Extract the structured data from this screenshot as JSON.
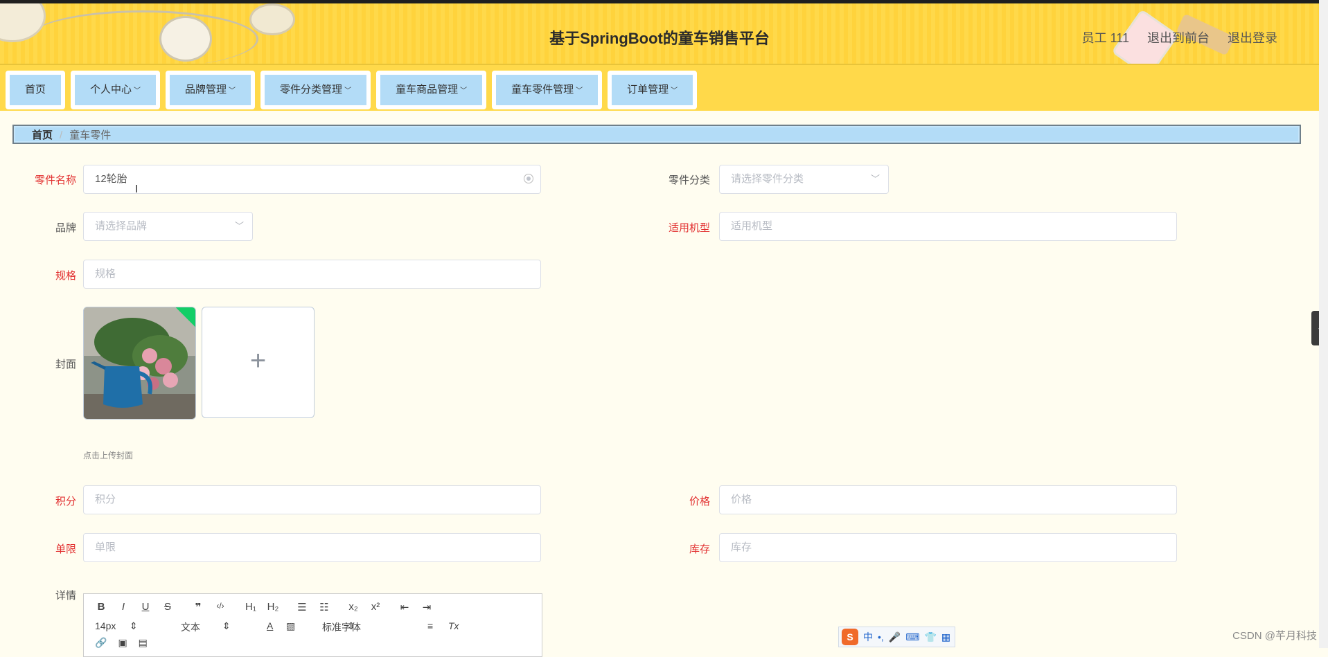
{
  "header": {
    "title": "基于SpringBoot的童车销售平台",
    "user": "员工 111",
    "to_front": "退出到前台",
    "logout": "退出登录"
  },
  "nav": [
    {
      "label": "首页",
      "has_menu": false
    },
    {
      "label": "个人中心",
      "has_menu": true
    },
    {
      "label": "品牌管理",
      "has_menu": true
    },
    {
      "label": "零件分类管理",
      "has_menu": true
    },
    {
      "label": "童车商品管理",
      "has_menu": true
    },
    {
      "label": "童车零件管理",
      "has_menu": true
    },
    {
      "label": "订单管理",
      "has_menu": true
    }
  ],
  "breadcrumb": {
    "home": "首页",
    "separator": "/",
    "current": "童车零件"
  },
  "form": {
    "part_name": {
      "label": "零件名称",
      "value": "12轮胎"
    },
    "part_category": {
      "label": "零件分类",
      "placeholder": "请选择零件分类"
    },
    "brand": {
      "label": "品牌",
      "placeholder": "请选择品牌"
    },
    "applicable_model": {
      "label": "适用机型",
      "placeholder": "适用机型"
    },
    "spec": {
      "label": "规格",
      "placeholder": "规格"
    },
    "cover": {
      "label": "封面",
      "tip": "点击上传封面"
    },
    "points": {
      "label": "积分",
      "placeholder": "积分"
    },
    "price": {
      "label": "价格",
      "placeholder": "价格"
    },
    "limit": {
      "label": "单限",
      "placeholder": "单限"
    },
    "stock": {
      "label": "库存",
      "placeholder": "库存"
    },
    "detail": {
      "label": "详情"
    }
  },
  "editor": {
    "font_size": "14px",
    "format": "文本",
    "font_family": "标准字体"
  },
  "ime": {
    "mode": "中"
  },
  "watermark": "CSDN @芊月科技",
  "colors": {
    "header": "#ffd94a",
    "nav_button": "#b3dcf7",
    "required": "#e23030"
  }
}
